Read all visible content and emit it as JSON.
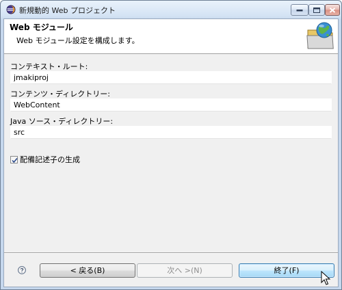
{
  "window": {
    "title": "新規動的 Web プロジェクト"
  },
  "banner": {
    "title": "Web モジュール",
    "description": "Web モジュール設定を構成します。"
  },
  "form": {
    "context_root_label": "コンテキスト・ルート:",
    "context_root_value": "jmakiproj",
    "content_dir_label": "コンテンツ・ディレクトリー:",
    "content_dir_value": "WebContent",
    "java_src_label": "Java ソース・ディレクトリー:",
    "java_src_value": "src",
    "generate_dd_label": "配備記述子の生成",
    "generate_dd_checked": true
  },
  "buttons": {
    "back": "< 戻る(B)",
    "next": "次へ >(N)",
    "finish": "終了(F)"
  },
  "icons": {
    "app": "eclipse-icon",
    "banner": "web-module-globe-folder-icon",
    "help": "help-icon"
  },
  "colors": {
    "finish_button_border": "#3c7fb1",
    "title_bar": "#d4e3f4"
  }
}
